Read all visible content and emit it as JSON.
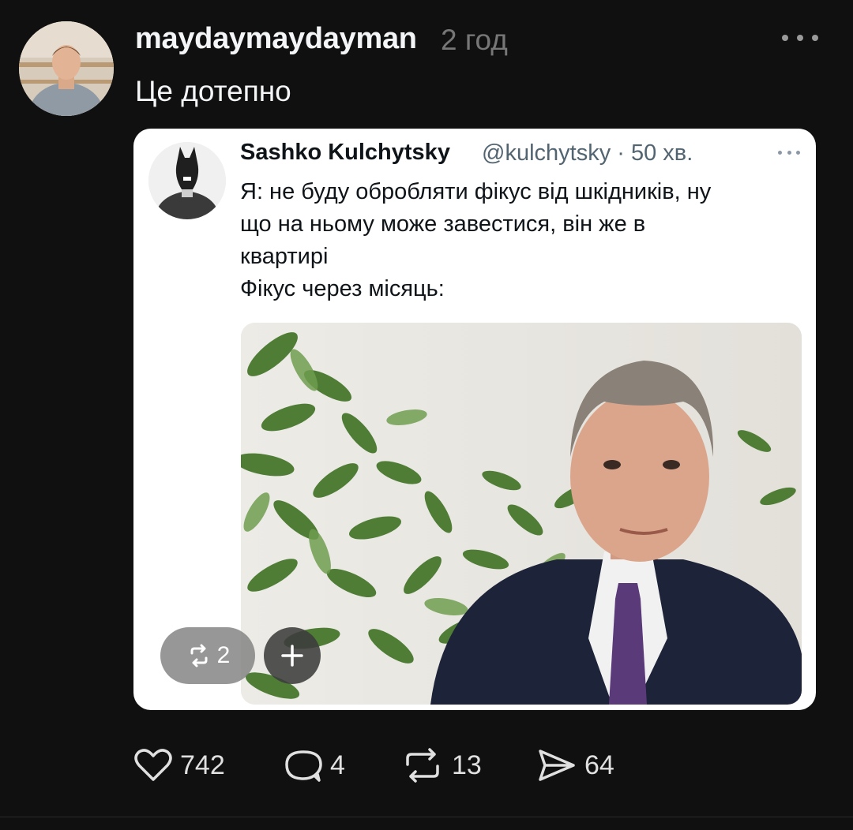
{
  "post": {
    "username": "maydaymaydayman",
    "time": "2 год",
    "text": "Це дотепно",
    "more_icon": "more-horizontal-icon"
  },
  "quoted_tweet": {
    "name": "Sashko Kulchytsky",
    "handle_time": "@kulchytsky · 50 хв.",
    "text_lines": [
      "Я: не буду обробляти фікус від шкідників, ну",
      "що на ньому може завестися, він же в",
      "квартирі",
      "Фікус через місяць:"
    ],
    "repost_count": "2"
  },
  "actions": {
    "likes": "742",
    "comments": "4",
    "reposts": "13",
    "shares": "64"
  },
  "colors": {
    "background": "#101010",
    "text_primary": "#f3f5f7",
    "text_secondary": "#777777",
    "card_bg": "#ffffff",
    "tweet_text": "#0f1419",
    "tweet_secondary": "#536471"
  }
}
